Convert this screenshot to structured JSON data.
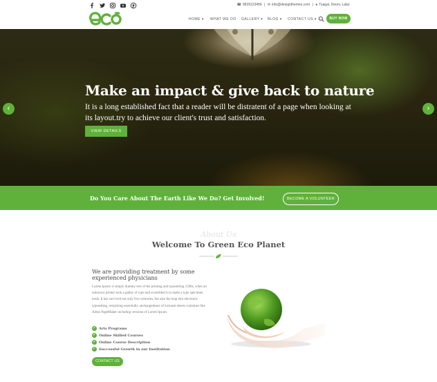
{
  "topbar": {
    "social": [
      "facebook-icon",
      "twitter-icon",
      "instagram-icon",
      "youtube-icon",
      "pinterest-icon"
    ],
    "phone": "9829123456",
    "email": "info@designthemes.com",
    "location": "Tyagai, Deoni, Latur"
  },
  "header": {
    "logo_text": "eco",
    "nav": [
      "HOME",
      "WHAT WE DO",
      "GALLERY",
      "BLOG",
      "CONTACT US"
    ],
    "buy_label": "BUY NOW"
  },
  "hero": {
    "title": "Make an impact & give back to nature",
    "subtitle": "It is a long established fact that a reader will be distratent of a page when looking at its layout.try to achieve our client's trust and satisfaction.",
    "button_label": "VIEW DETAILS",
    "prev_arrow": "‹",
    "next_arrow": "›"
  },
  "banner": {
    "text": "Do You Care About The Earth Like We Do? Get Involved!",
    "button_label": "BECOME A VOLUNTEER"
  },
  "welcome": {
    "script_text": "About Us",
    "title": "Welcome To Green Eco Planet",
    "heading": "We are providing treatment by some experienced physicians",
    "body": "Lorem Ipsum is simply dummy text of the printing and typesetting 1500s, when an unknown printer took a galley of type and scrambled it to make a type specimen book. It has survived not only five centuries, but also the leap into electronic typesetting, remaining essentially unchangedease of Letraset sheets containes like Aldus PageMaker including versions of Lorem Ipsum.",
    "features": [
      "Arts Programs",
      "Online Skilled Courses",
      "Online Course Description",
      "Successful Growth in our Institution"
    ],
    "contact_label": "CONTACT US"
  },
  "colors": {
    "accent": "#5fb13b"
  }
}
